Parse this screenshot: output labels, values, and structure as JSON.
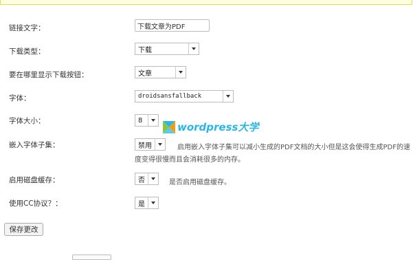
{
  "form": {
    "link_text": {
      "label": "链接文字：",
      "value": "下载文章为PDF"
    },
    "download_type": {
      "label": "下载类型：",
      "selected": "下载"
    },
    "button_location": {
      "label": "要在哪里显示下载按钮：",
      "selected": "文章"
    },
    "font": {
      "label": "字体：",
      "selected": "droidsansfallback"
    },
    "font_size": {
      "label": "字体大小：",
      "selected": "8"
    },
    "embed_subset": {
      "label": "嵌入字体子集：",
      "selected": "禁用",
      "description_line1": "启用嵌入字体子集可以减小生成的PDF文档的大小但是这会使得生成PDF的速",
      "description_line2": "度变得很慢而且会消耗很多的内存。"
    },
    "disk_cache": {
      "label": "启用磁盘缓存：",
      "selected": "否",
      "description": "是否启用磁盘缓存。"
    },
    "cc_license": {
      "label": "使用CC协议？：",
      "selected": "是"
    }
  },
  "save_button": {
    "label": "保存更改"
  },
  "watermark": {
    "text": "wordpress大学",
    "colors": {
      "green": "#8cc63f",
      "blue": "#2ab7e6",
      "orange": "#f39c12"
    }
  },
  "colors": {
    "notice_bg": "#ffffe0",
    "notice_border": "#e6db55"
  }
}
